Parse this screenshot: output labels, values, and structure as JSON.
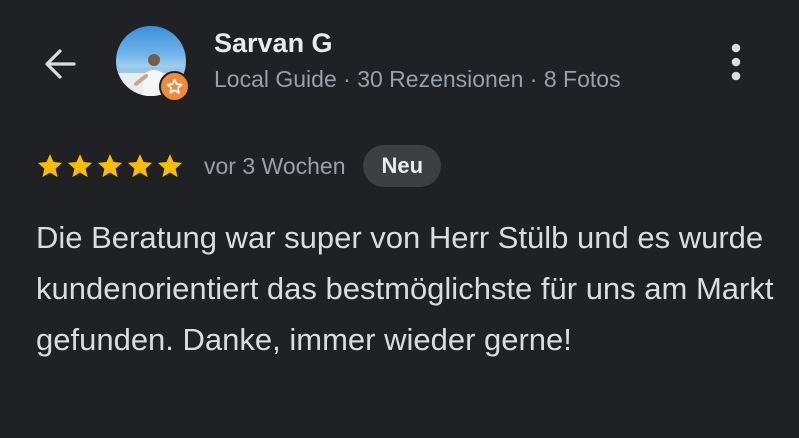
{
  "reviewer": {
    "name": "Sarvan G",
    "meta": "Local Guide · 30 Rezensionen · 8 Fotos",
    "avatar": "profile-photo",
    "badge_icon": "local-guide-star-icon"
  },
  "review": {
    "rating": 5,
    "rating_max": 5,
    "age": "vor 3 Wochen",
    "badge": "Neu",
    "text": "Die Beratung war super von Herr Stülb und es wurde kundenorientiert das bestmöglichste für uns am Markt gefunden. Danke, immer wieder gerne!"
  },
  "icons": {
    "back": "arrow-back-icon",
    "more": "more-vertical-icon",
    "star": "star-icon"
  },
  "colors": {
    "background": "#202124",
    "star": "#fbbc04",
    "badge_bg": "#3c4043",
    "guide_badge": "#f28b39"
  }
}
